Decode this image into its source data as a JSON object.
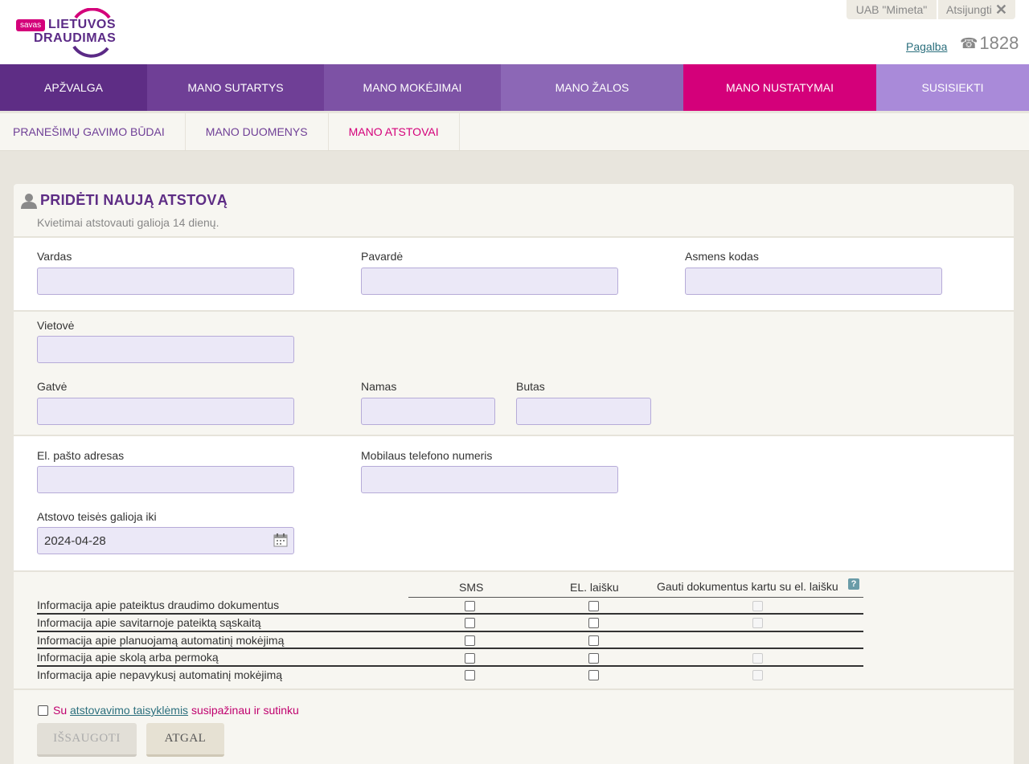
{
  "header": {
    "logo_badge": "savas",
    "logo_line1": "LIETUVOS",
    "logo_line2": "DRAUDIMAS",
    "company": "UAB \"Mimeta\"",
    "logout": "Atsijungti",
    "help": "Pagalba",
    "phone": "1828"
  },
  "mainnav": [
    "APŽVALGA",
    "MANO SUTARTYS",
    "MANO MOKĖJIMAI",
    "MANO ŽALOS",
    "MANO NUSTATYMAI",
    "SUSISIEKTI"
  ],
  "subnav": [
    "PRANEŠIMŲ GAVIMO BŪDAI",
    "MANO DUOMENYS",
    "MANO ATSTOVAI"
  ],
  "form": {
    "title": "PRIDĖTI NAUJĄ ATSTOVĄ",
    "subtitle": "Kvietimai atstovauti galioja 14 dienų.",
    "vardas": "Vardas",
    "pavarde": "Pavardė",
    "asmens_kodas": "Asmens kodas",
    "vietove": "Vietovė",
    "gatve": "Gatvė",
    "namas": "Namas",
    "butas": "Butas",
    "email": "El. pašto adresas",
    "mobile": "Mobilaus telefono numeris",
    "valid_until_label": "Atstovo teisės galioja iki",
    "valid_until_value": "2024-04-28"
  },
  "table": {
    "headers": [
      "SMS",
      "EL. laišku",
      "Gauti dokumentus kartu su el. laišku"
    ],
    "help_mark": "?",
    "rows": [
      "Informacija apie pateiktus draudimo dokumentus",
      "Informacija apie savitarnoje pateiktą sąskaitą",
      "Informacija apie planuojamą automatinį mokėjimą",
      "Informacija apie skolą arba permoką",
      "Informacija apie nepavykusį automatinį mokėjimą"
    ]
  },
  "agree": {
    "prefix": "Su",
    "link": "atstovavimo taisyklėmis",
    "suffix": "susipažinau ir sutinku"
  },
  "buttons": {
    "save": "IŠSAUGOTI",
    "back": "ATGAL"
  }
}
